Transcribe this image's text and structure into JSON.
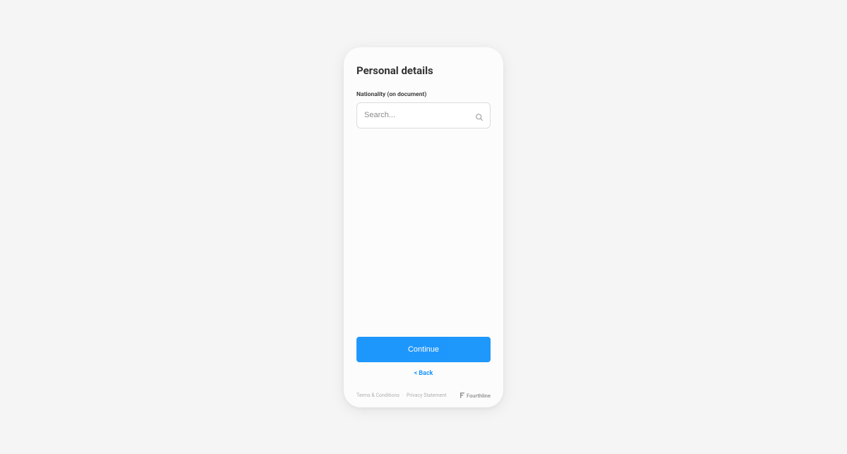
{
  "header": {
    "title": "Personal details"
  },
  "form": {
    "nationality_label": "Nationality (on document)",
    "search_placeholder": "Search..."
  },
  "actions": {
    "continue_label": "Continue",
    "back_label": "< Back"
  },
  "footer": {
    "terms_label": "Terms & Conditions",
    "separator": "·",
    "privacy_label": "Privacy Statement",
    "brand_name": "Fourthline"
  }
}
